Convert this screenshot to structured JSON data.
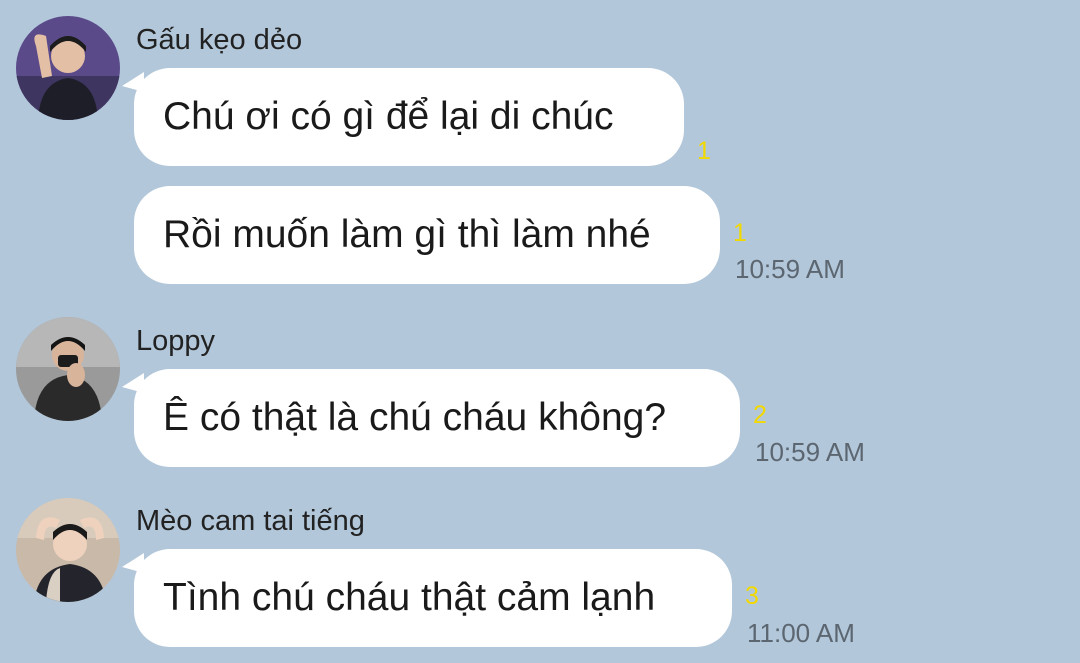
{
  "messages": [
    {
      "sender": "Gấu kẹo dẻo",
      "avatar_icon": "user-avatar-icon",
      "bubbles": [
        {
          "text": "Chú ơi có gì để lại di chúc",
          "unread": "1",
          "time": ""
        },
        {
          "text": "Rồi muốn làm gì thì làm nhé",
          "unread": "1",
          "time": "10:59 AM"
        }
      ]
    },
    {
      "sender": "Loppy",
      "avatar_icon": "user-avatar-icon",
      "bubbles": [
        {
          "text": "Ê có thật là chú cháu không?",
          "unread": "2",
          "time": "10:59 AM"
        }
      ]
    },
    {
      "sender": "Mèo cam tai tiếng",
      "avatar_icon": "user-avatar-icon",
      "bubbles": [
        {
          "text": "Tình chú cháu thật cảm lạnh",
          "unread": "3",
          "time": "11:00 AM"
        }
      ]
    }
  ],
  "colors": {
    "background": "#b2c7da",
    "bubble": "#ffffff",
    "unread": "#f2d900",
    "time": "#5c6670"
  }
}
